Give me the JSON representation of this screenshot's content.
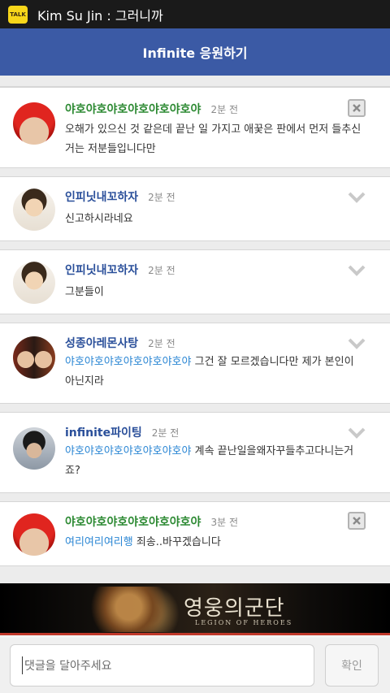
{
  "status_bar": {
    "app_icon_label": "TALK",
    "notification_text": "Kim Su Jin : 그러니까"
  },
  "header": {
    "title": "Infinite 응원하기"
  },
  "comments": [
    {
      "author": "야호야호야호야호야호야호야",
      "time": "2분 전",
      "mention": "",
      "text": "오해가 있으신 것 같은데 끝난 일 가지고 애꿎은 판에서 먼저 들추신 거는 저분들입니다만",
      "action_icon": "delete-icon"
    },
    {
      "author": "인피닛내꼬하자",
      "time": "2분 전",
      "mention": "",
      "text": "신고하시라네요",
      "action_icon": "chevron-down-icon"
    },
    {
      "author": "인피닛내꼬하자",
      "time": "2분 전",
      "mention": "",
      "text": "그분들이",
      "action_icon": "chevron-down-icon"
    },
    {
      "author": "성종아레몬사탕",
      "time": "2분 전",
      "mention": "야호야호야호야호야호야호야",
      "text": " 그건 잘 모르겠습니다만 제가 본인이 아닌지라",
      "action_icon": "chevron-down-icon"
    },
    {
      "author": "infinite파이팅",
      "time": "2분 전",
      "mention": "야호야호야호야호야호야호야",
      "text": " 계속 끝난일을왜자꾸들추고다니는거죠?",
      "action_icon": "chevron-down-icon"
    },
    {
      "author": "야호야호야호야호야호야호야",
      "time": "3분 전",
      "mention": "여리여리여리행",
      "text": " 죄송..바꾸겠습니다",
      "action_icon": "delete-icon"
    }
  ],
  "ad": {
    "title": "영웅의군단",
    "subtitle": "LEGION OF HEROES"
  },
  "input": {
    "placeholder": "댓글을 달아주세요",
    "confirm_label": "확인"
  },
  "colors": {
    "header_bg": "#3b5aa5",
    "author_green": "#2d8a33",
    "author_blue": "#2a4f9a",
    "mention_blue": "#2a86d4"
  }
}
